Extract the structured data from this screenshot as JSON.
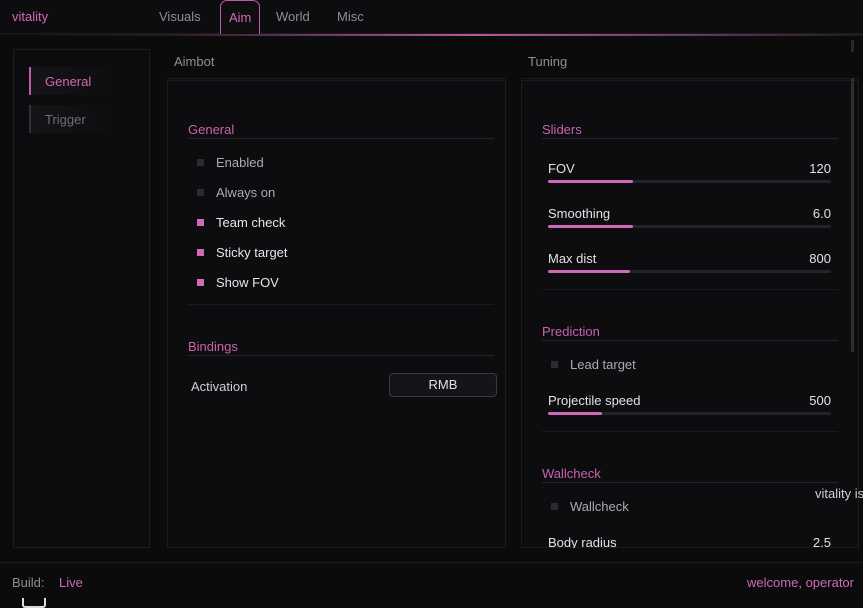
{
  "app": {
    "brand": "vitality"
  },
  "tabs": [
    {
      "label": "Visuals",
      "active": false
    },
    {
      "label": "Aim",
      "active": true
    },
    {
      "label": "World",
      "active": false
    },
    {
      "label": "Misc",
      "active": false
    }
  ],
  "sidebar": {
    "items": [
      {
        "label": "General",
        "active": true
      },
      {
        "label": "Trigger",
        "active": false
      }
    ]
  },
  "aimbot": {
    "title": "Aimbot",
    "general": {
      "title": "General",
      "checks": [
        {
          "label": "Enabled",
          "checked": false
        },
        {
          "label": "Always on",
          "checked": false
        },
        {
          "label": "Team check",
          "checked": true
        },
        {
          "label": "Sticky target",
          "checked": true
        },
        {
          "label": "Show FOV",
          "checked": true
        }
      ]
    },
    "bindings": {
      "title": "Bindings",
      "activation_label": "Activation",
      "activation_key": "RMB"
    }
  },
  "tuning": {
    "title": "Tuning",
    "sliders": {
      "title": "Sliders",
      "items": [
        {
          "label": "FOV",
          "value": "120",
          "fraction": 0.3
        },
        {
          "label": "Smoothing",
          "value": "6.0",
          "fraction": 0.3
        },
        {
          "label": "Max dist",
          "value": "800",
          "fraction": 0.29
        }
      ]
    },
    "prediction": {
      "title": "Prediction",
      "lead_label": "Lead target",
      "lead_checked": false,
      "proj_label": "Projectile speed",
      "proj_value": "500",
      "proj_fraction": 0.19
    },
    "wallcheck": {
      "title": "Wallcheck",
      "check_label": "Wallcheck",
      "check_checked": false,
      "radius_label": "Body radius",
      "radius_value": "2.5"
    }
  },
  "tooltip": "vitality is",
  "footer": {
    "build_label": "Build:",
    "build_value": "Live",
    "welcome": "welcome, operator"
  },
  "colors": {
    "accent": "#d06ab8",
    "background": "#0b0b0c"
  }
}
